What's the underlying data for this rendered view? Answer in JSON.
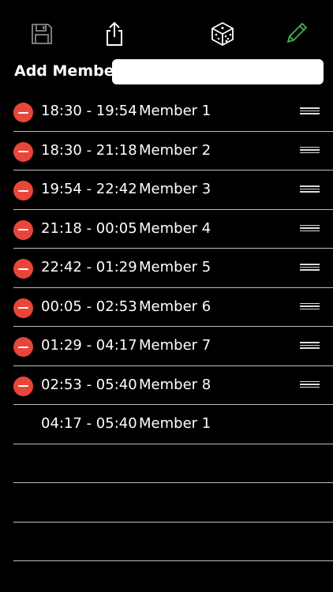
{
  "toolbar": {
    "save_icon": "save-icon",
    "share_icon": "share-icon",
    "dice_icon": "dice-icon",
    "edit_icon": "pencil-icon",
    "edit_color": "#4caf50"
  },
  "add_member": {
    "label": "Add Member",
    "value": "",
    "placeholder": ""
  },
  "members": [
    {
      "time": "18:30 - 19:54",
      "name": "Member 1",
      "editable": true
    },
    {
      "time": "18:30 - 21:18",
      "name": "Member 2",
      "editable": true
    },
    {
      "time": "19:54 - 22:42",
      "name": "Member 3",
      "editable": true
    },
    {
      "time": "21:18 - 00:05",
      "name": "Member 4",
      "editable": true
    },
    {
      "time": "22:42 - 01:29",
      "name": "Member 5",
      "editable": true
    },
    {
      "time": "00:05 - 02:53",
      "name": "Member 6",
      "editable": true
    },
    {
      "time": "01:29 - 04:17",
      "name": "Member 7",
      "editable": true
    },
    {
      "time": "02:53 - 05:40",
      "name": "Member 8",
      "editable": true
    },
    {
      "time": "04:17 - 05:40",
      "name": "Member 1",
      "editable": false
    },
    {
      "time": "",
      "name": "",
      "editable": false
    },
    {
      "time": "",
      "name": "",
      "editable": false
    },
    {
      "time": "",
      "name": "",
      "editable": false
    }
  ],
  "colors": {
    "background": "#000000",
    "delete": "#e8463b",
    "separator": "#bdbdbd"
  }
}
